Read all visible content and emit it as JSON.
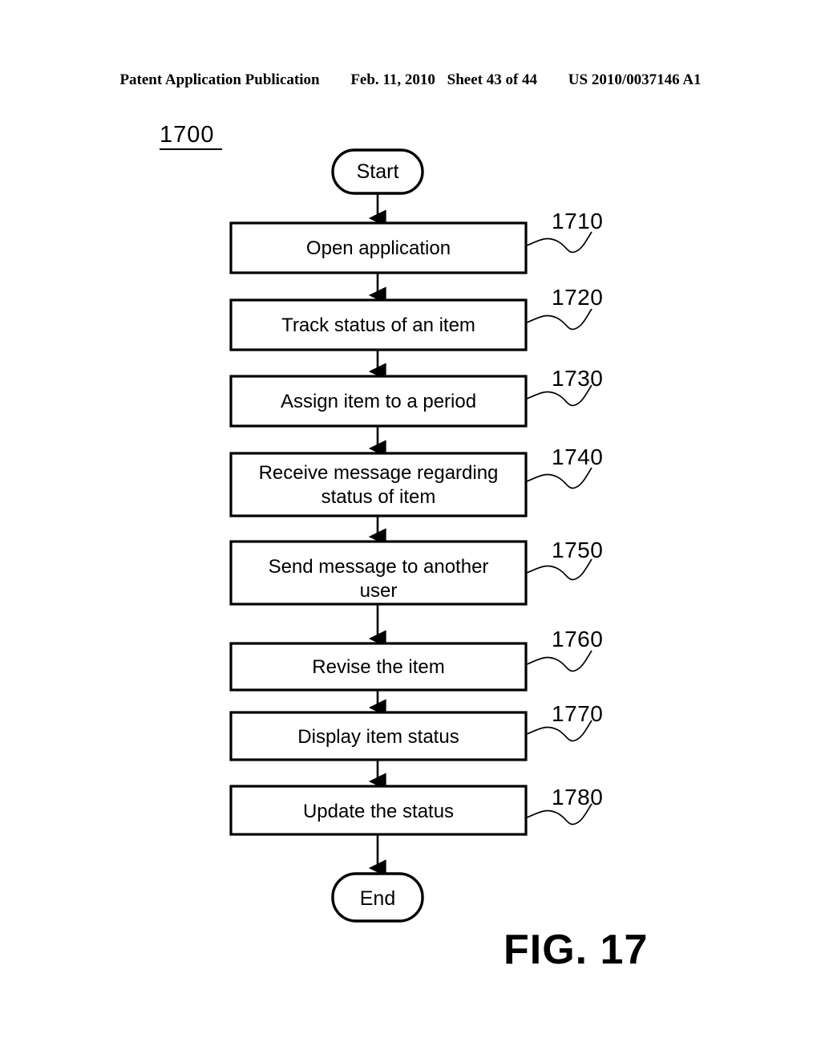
{
  "header": {
    "publication": "Patent Application Publication",
    "date": "Feb. 11, 2010",
    "sheet": "Sheet 43 of 44",
    "patent_number": "US 2010/0037146 A1"
  },
  "figure": {
    "reference_number": "1700",
    "caption": "FIG. 17"
  },
  "flowchart": {
    "start_label": "Start",
    "end_label": "End",
    "steps": [
      {
        "label": "Open application",
        "ref": "1710",
        "lines": [
          "Open application"
        ]
      },
      {
        "label": "Track status of an item",
        "ref": "1720",
        "lines": [
          "Track status of an item"
        ]
      },
      {
        "label": "Assign item to a period",
        "ref": "1730",
        "lines": [
          "Assign item to a period"
        ]
      },
      {
        "label": "Receive message regarding status of item",
        "ref": "1740",
        "lines": [
          "Receive message regarding",
          "status of item"
        ]
      },
      {
        "label": "Send message to another user",
        "ref": "1750",
        "lines": [
          "Send message to another",
          "user"
        ]
      },
      {
        "label": "Revise the item",
        "ref": "1760",
        "lines": [
          "Revise the item"
        ]
      },
      {
        "label": "Display item status",
        "ref": "1770",
        "lines": [
          "Display item status"
        ]
      },
      {
        "label": "Update the status",
        "ref": "1780",
        "lines": [
          "Update the status"
        ]
      }
    ]
  },
  "colors": {
    "ink": "#000000",
    "paper": "#ffffff"
  }
}
